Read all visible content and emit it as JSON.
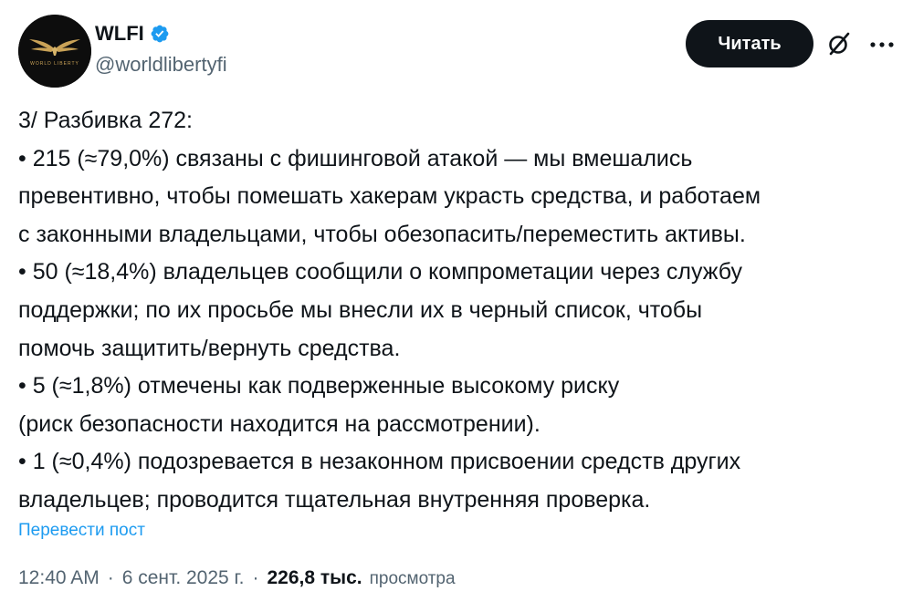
{
  "author": {
    "display_name": "WLFI",
    "handle": "@worldlibertyfi",
    "avatar_text": "WORLD LIBERTY",
    "verified": true
  },
  "header": {
    "follow_label": "Читать",
    "grok_icon": "grok-icon",
    "more_icon": "more-icon"
  },
  "tweet": {
    "lines": [
      "3/ Разбивка 272:",
      "• 215 (≈79,0%) связаны с фишинговой атакой — мы вмешались",
      "превентивно, чтобы помешать хакерам украсть средства, и работаем",
      "с законными владельцами, чтобы обезопасить/переместить активы.",
      "• 50 (≈18,4%) владельцев сообщили о компрометации через службу",
      "поддержки; по их просьбе мы внесли их в черный список, чтобы",
      "помочь защитить/вернуть средства.",
      "• 5 (≈1,8%) отмечены как подверженные высокому риску",
      "(риск безопасности находится на рассмотрении).",
      "• 1 (≈0,4%) подозревается в незаконном присвоении средств других",
      "владельцев; проводится тщательная внутренняя проверка."
    ],
    "translate_label": "Перевести пост"
  },
  "meta": {
    "time": "12:40 AM",
    "separator": "·",
    "date": "6 сент. 2025 г.",
    "views_count": "226,8 тыс.",
    "views_label": "просмотра"
  },
  "colors": {
    "text": "#0f1419",
    "secondary": "#536471",
    "link": "#1d9bf0",
    "verified": "#1d9bf0",
    "button_bg": "#0f1419",
    "avatar_bg": "#0d0d0d",
    "avatar_gold": "#c9a257"
  }
}
